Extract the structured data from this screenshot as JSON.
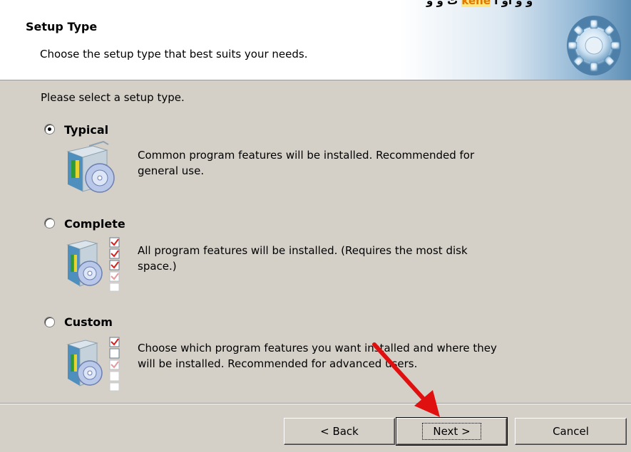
{
  "header": {
    "top_fragment_prefix": "ت و و ",
    "top_fragment_highlight": "kene",
    "top_fragment_suffix": " و و او ا",
    "title": "Setup Type",
    "subtitle": "Choose the setup type that best suits your needs.",
    "icon": "gear-icon"
  },
  "prompt": "Please select a setup type.",
  "options": [
    {
      "label": "Typical",
      "selected": true,
      "description_line1": "Common program features will be installed. Recommended for",
      "description_line2": "general use.",
      "icon": "install-package-icon"
    },
    {
      "label": "Complete",
      "selected": false,
      "description_line1": "All program features will be installed. (Requires the most disk",
      "description_line2": "space.)",
      "icon": "install-package-checklist-icon"
    },
    {
      "label": "Custom",
      "selected": false,
      "description_line1": "Choose which program features you want installed and where they",
      "description_line2": "will be installed. Recommended for advanced users.",
      "icon": "install-package-partial-checklist-icon"
    }
  ],
  "buttons": {
    "back": "< Back",
    "next": "Next >",
    "cancel": "Cancel"
  },
  "colors": {
    "dialog_bg": "#d4d0c8",
    "header_bg": "#ffffff",
    "arrow": "#e01010"
  }
}
